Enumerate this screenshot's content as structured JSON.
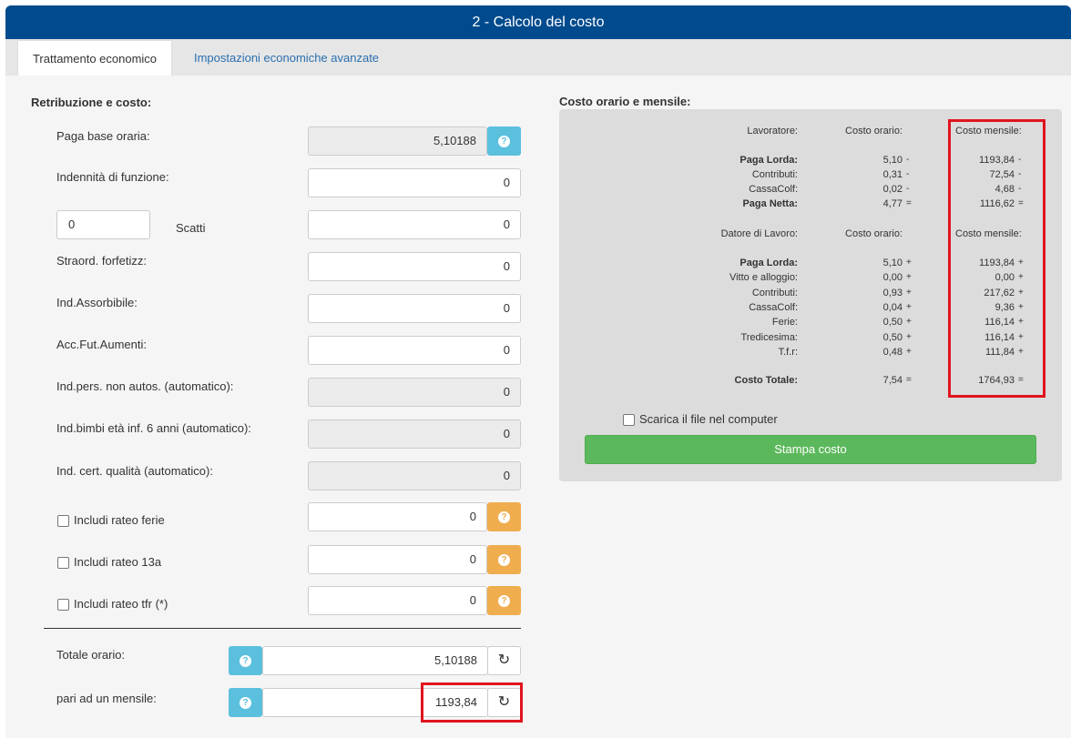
{
  "header": {
    "title": "2 - Calcolo del costo"
  },
  "tabs": [
    {
      "label": "Trattamento economico"
    },
    {
      "label": "Impostazioni economiche avanzate"
    }
  ],
  "left": {
    "title": "Retribuzione e costo:",
    "paga_base": {
      "label": "Paga base oraria:",
      "value": "5,10188"
    },
    "indennita": {
      "label": "Indennità di funzione:",
      "value": "0"
    },
    "scatti": {
      "count": "0",
      "label": "Scatti",
      "value": "0"
    },
    "straord": {
      "label": "Straord. forfetizz:",
      "value": "0"
    },
    "ind_assorbibile": {
      "label": "Ind.Assorbibile:",
      "value": "0"
    },
    "acc_fut": {
      "label": "Acc.Fut.Aumenti:",
      "value": "0"
    },
    "ind_pers": {
      "label": "Ind.pers. non autos. (automatico):",
      "value": "0"
    },
    "ind_bimbi": {
      "label": "Ind.bimbi età inf. 6 anni (automatico):",
      "value": "0"
    },
    "ind_cert": {
      "label": "Ind. cert. qualità (automatico):",
      "value": "0"
    },
    "rateo_ferie": {
      "label": "Includi rateo ferie",
      "value": "0"
    },
    "rateo_13": {
      "label": "Includi rateo 13a",
      "value": "0"
    },
    "rateo_tfr": {
      "label": "Includi rateo tfr (*)",
      "value": "0"
    },
    "totale_orario": {
      "label": "Totale orario:",
      "value": "5,10188"
    },
    "mensile": {
      "label": "pari ad un mensile:",
      "value": "1193,84"
    }
  },
  "right": {
    "title": "Costo orario e mensile:",
    "lav_header": {
      "label": "Lavoratore:",
      "orario": "Costo orario:",
      "mensile": "Costo mensile:"
    },
    "lav_rows": [
      {
        "label": "Paga Lorda:",
        "orario": "5,10",
        "os": "-",
        "mensile": "1193,84",
        "ms": "-"
      },
      {
        "label": "Contributi:",
        "orario": "0,31",
        "os": "-",
        "mensile": "72,54",
        "ms": "-"
      },
      {
        "label": "CassaColf:",
        "orario": "0,02",
        "os": "-",
        "mensile": "4,68",
        "ms": "-"
      },
      {
        "label": "Paga Netta:",
        "orario": "4,77",
        "os": "=",
        "mensile": "1116,62",
        "ms": "="
      }
    ],
    "dat_header": {
      "label": "Datore di Lavoro:",
      "orario": "Costo orario:",
      "mensile": "Costo mensile:"
    },
    "dat_rows": [
      {
        "label": "Paga Lorda:",
        "orario": "5,10",
        "os": "+",
        "mensile": "1193,84",
        "ms": "+"
      },
      {
        "label": "Vitto e alloggio:",
        "orario": "0,00",
        "os": "+",
        "mensile": "0,00",
        "ms": "+"
      },
      {
        "label": "Contributi:",
        "orario": "0,93",
        "os": "+",
        "mensile": "217,62",
        "ms": "+"
      },
      {
        "label": "CassaColf:",
        "orario": "0,04",
        "os": "+",
        "mensile": "9,36",
        "ms": "+"
      },
      {
        "label": "Ferie:",
        "orario": "0,50",
        "os": "+",
        "mensile": "116,14",
        "ms": "+"
      },
      {
        "label": "Tredicesima:",
        "orario": "0,50",
        "os": "+",
        "mensile": "116,14",
        "ms": "+"
      },
      {
        "label": "T.f.r:",
        "orario": "0,48",
        "os": "+",
        "mensile": "111,84",
        "ms": "+"
      }
    ],
    "totale": {
      "label": "Costo Totale:",
      "orario": "7,54",
      "os": "=",
      "mensile": "1764,93",
      "ms": "="
    },
    "download_label": "Scarica il file nel computer",
    "print_button": "Stampa costo"
  },
  "colors": {
    "header": "#004b8d",
    "info_button": "#5bc0de",
    "warning_button": "#f0ad4e",
    "print_button": "#5cb85c",
    "highlight": "#e0141e"
  }
}
